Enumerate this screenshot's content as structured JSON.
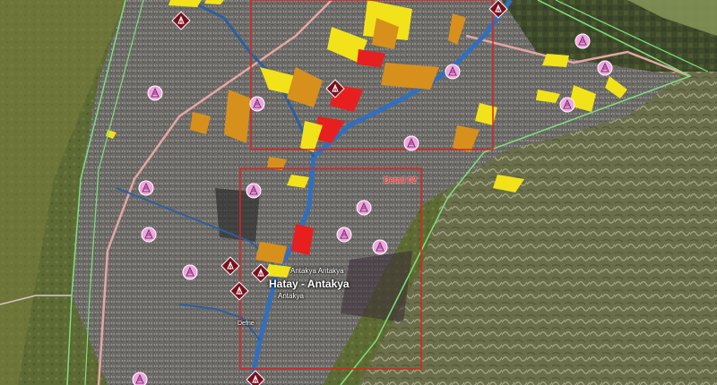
{
  "map": {
    "labels": {
      "detail_frame": "Detail 02",
      "district_upper": "Antakya  Antakya",
      "city": "Hatay - Antakya",
      "district_small": "Antakya",
      "river": "Defne"
    },
    "colors": {
      "urban": "#6b6a66",
      "forest_hills": "#5e6a34",
      "mountains": "#8a8a6a",
      "river": "#2f6fc0",
      "highway": "#e6a5a5",
      "boundary": "#7ee07a",
      "frame": "#e02020",
      "zone_yellow": "#f2e21a",
      "zone_orange": "#d8901c",
      "zone_red": "#e81f1f",
      "marker_pink": "#f0a6e0",
      "marker_maroon": "#7a0f1e"
    },
    "icons": {
      "pink_marker": "tower-icon",
      "maroon_marker": "station-icon"
    }
  }
}
